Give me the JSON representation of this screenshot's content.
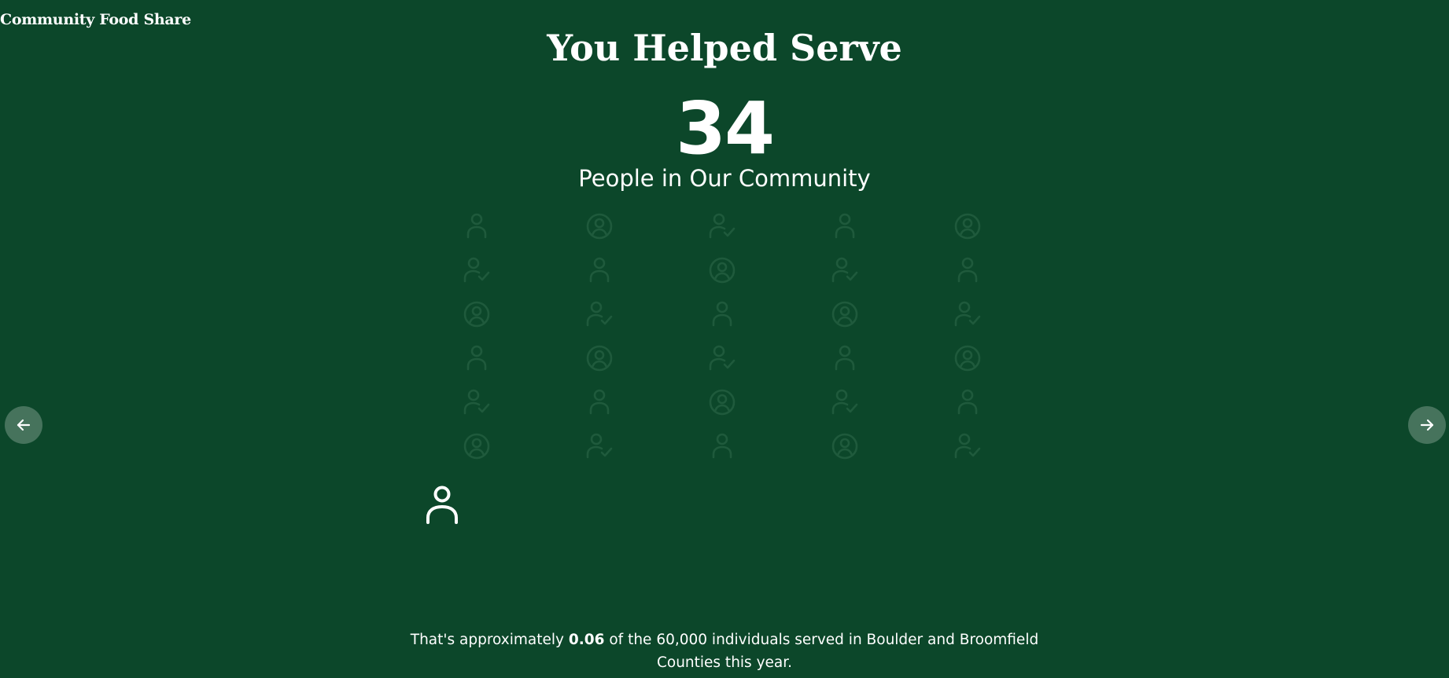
{
  "header": {
    "brand": "Community Food Share"
  },
  "slide": {
    "title": "You Helped Serve",
    "count": "34",
    "count_caption": "People in Our Community",
    "footnote": {
      "before": "That's approximately ",
      "highlight": "0.06",
      "after": " of the 60,000 individuals served in Boulder and Broomfield Counties this year."
    }
  },
  "ghost_grid": {
    "rows": [
      [
        "person-icon",
        "person-circle-icon",
        "person-check-icon",
        "person-icon",
        "person-circle-icon"
      ],
      [
        "person-check-icon",
        "person-icon",
        "person-circle-icon",
        "person-check-icon",
        "person-icon"
      ],
      [
        "person-circle-icon",
        "person-check-icon",
        "person-icon",
        "person-circle-icon",
        "person-check-icon"
      ],
      [
        "person-icon",
        "person-circle-icon",
        "person-check-icon",
        "person-icon",
        "person-circle-icon"
      ],
      [
        "person-check-icon",
        "person-icon",
        "person-circle-icon",
        "person-check-icon",
        "person-icon"
      ],
      [
        "person-circle-icon",
        "person-check-icon",
        "person-icon",
        "person-circle-icon",
        "person-check-icon"
      ]
    ]
  },
  "served_icon": "person-icon",
  "navigation": {
    "prev_icon": "arrow-left-icon",
    "next_icon": "arrow-right-icon"
  },
  "colors": {
    "background": "#0c472a",
    "text": "#ffffff",
    "ghost_icon": "#1f5a3c",
    "nav_button": "rgba(255,255,255,0.24)"
  }
}
